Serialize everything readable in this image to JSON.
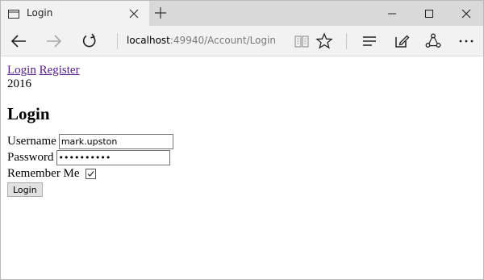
{
  "tab": {
    "title": "Login"
  },
  "address": {
    "host": "localhost",
    "path": ":49940/Account/Login"
  },
  "nav_links": {
    "login": "Login",
    "register": "Register"
  },
  "footer_text": "2016",
  "page_title": "Login",
  "form": {
    "username_label": "Username",
    "username_value": "mark.upston",
    "password_label": "Password",
    "password_value": "markupston",
    "remember_label": "Remember Me",
    "remember_checked": true,
    "submit_label": "Login"
  }
}
